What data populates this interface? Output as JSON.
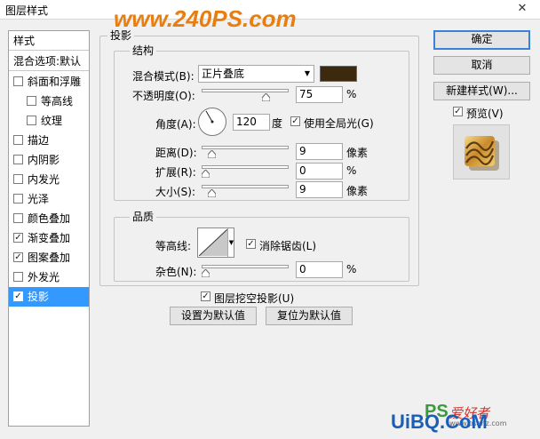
{
  "window": {
    "title": "图层样式",
    "close_glyph": "✕"
  },
  "watermark_top": "www.240PS.com",
  "style_list": {
    "header": "样式",
    "blend_default": "混合选项:默认",
    "items": [
      {
        "label": "斜面和浮雕",
        "checked": false,
        "indent": false
      },
      {
        "label": "等高线",
        "checked": false,
        "indent": true
      },
      {
        "label": "纹理",
        "checked": false,
        "indent": true
      },
      {
        "label": "描边",
        "checked": false,
        "indent": false
      },
      {
        "label": "内阴影",
        "checked": false,
        "indent": false
      },
      {
        "label": "内发光",
        "checked": false,
        "indent": false
      },
      {
        "label": "光泽",
        "checked": false,
        "indent": false
      },
      {
        "label": "颜色叠加",
        "checked": false,
        "indent": false
      },
      {
        "label": "渐变叠加",
        "checked": true,
        "indent": false
      },
      {
        "label": "图案叠加",
        "checked": true,
        "indent": false
      },
      {
        "label": "外发光",
        "checked": false,
        "indent": false
      },
      {
        "label": "投影",
        "checked": true,
        "indent": false,
        "selected": true
      }
    ]
  },
  "shadow": {
    "section_title": "投影",
    "structure_title": "结构",
    "blend_mode_label": "混合模式(B):",
    "blend_mode_value": "正片叠底",
    "color": "#3d2a0e",
    "opacity_label": "不透明度(O):",
    "opacity_value": "75",
    "opacity_fraction": 0.75,
    "percent": "%",
    "angle_label": "角度(A):",
    "angle_value": "120",
    "angle_unit": "度",
    "use_global_light_label": "使用全局光(G)",
    "use_global_light": true,
    "distance_label": "距离(D):",
    "distance_value": "9",
    "distance_fraction": 0.08,
    "spread_label": "扩展(R):",
    "spread_value": "0",
    "spread_fraction": 0.0,
    "size_label": "大小(S):",
    "size_value": "9",
    "size_fraction": 0.08,
    "pixel_unit": "像素",
    "quality_title": "品质",
    "contour_label": "等高线:",
    "anti_alias_label": "消除锯齿(L)",
    "anti_alias": true,
    "noise_label": "杂色(N):",
    "noise_value": "0",
    "noise_fraction": 0.0,
    "knockout_label": "图层挖空投影(U)",
    "knockout": true,
    "make_default_label": "设置为默认值",
    "reset_default_label": "复位为默认值"
  },
  "actions": {
    "ok_label": "确定",
    "cancel_label": "取消",
    "new_style_label": "新建样式(W)...",
    "preview_label": "预览(V)",
    "preview_checked": true
  },
  "watermark_bottom": {
    "logo": "PS",
    "cn": "爱好者",
    "url": "www.psahz.com",
    "brand": "UiBQ.CoM"
  },
  "colors": {
    "accent": "#3399ff",
    "selected_text": "#ffffff",
    "watermark_orange": "#e87e10"
  }
}
